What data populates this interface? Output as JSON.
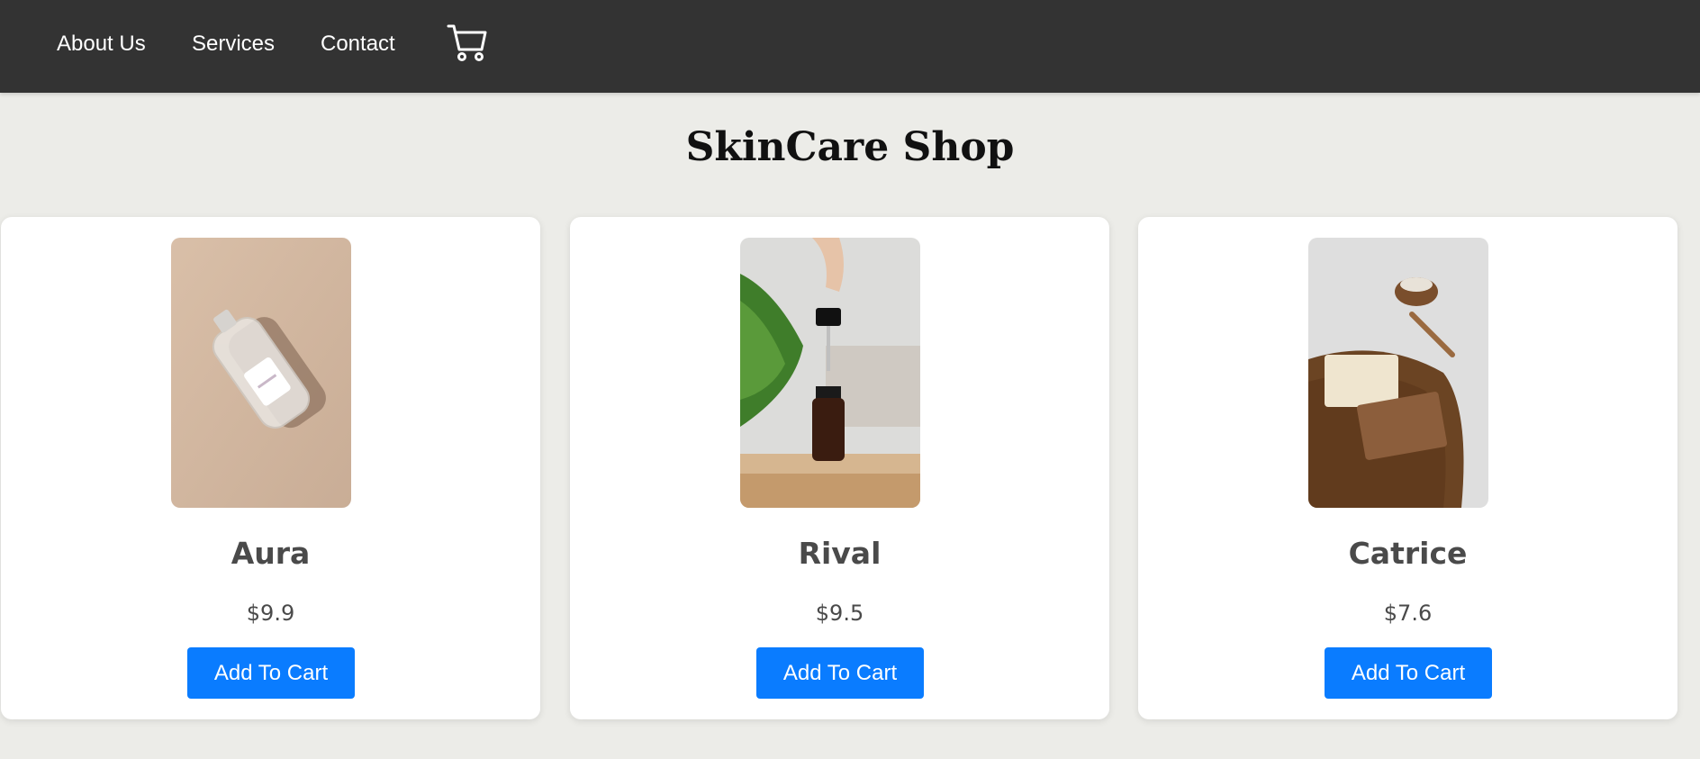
{
  "nav": {
    "links": [
      {
        "label": "About Us"
      },
      {
        "label": "Services"
      },
      {
        "label": "Contact"
      }
    ],
    "cart_icon": "shopping-cart-icon"
  },
  "page": {
    "title": "SkinCare Shop"
  },
  "products": [
    {
      "name": "Aura",
      "price": "$9.9",
      "button_label": "Add To Cart",
      "image": "clear-bottle-photo"
    },
    {
      "name": "Rival",
      "price": "$9.5",
      "button_label": "Add To Cart",
      "image": "serum-dropper-photo"
    },
    {
      "name": "Catrice",
      "price": "$7.6",
      "button_label": "Add To Cart",
      "image": "soap-bars-photo"
    }
  ],
  "colors": {
    "navbar": "#333333",
    "background": "#ecece8",
    "button": "#0a7cff",
    "text": "#4a4a4a"
  }
}
